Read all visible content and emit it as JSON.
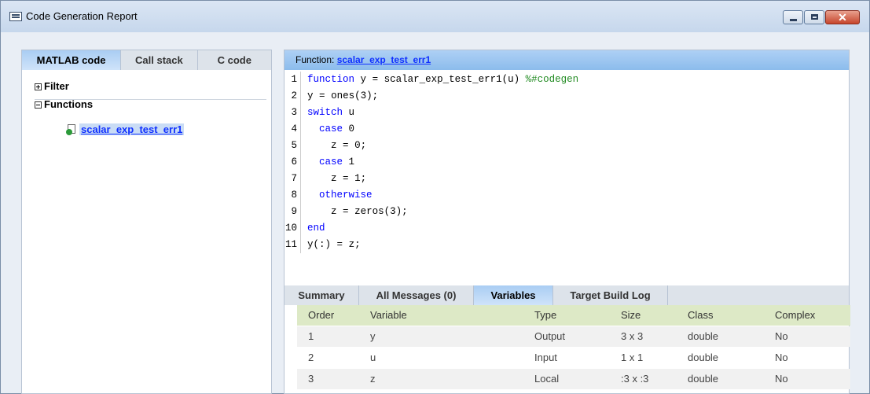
{
  "window": {
    "title": "Code Generation Report",
    "close_glyph": "✕"
  },
  "left_tabs": [
    "MATLAB code",
    "Call stack",
    "C code"
  ],
  "tree": {
    "filter_label": "Filter",
    "functions_label": "Functions",
    "function_item": "scalar_exp_test_err1"
  },
  "function_header": {
    "prefix": "Function:",
    "name": "scalar_exp_test_err1"
  },
  "code_lines": [
    {
      "num": "1",
      "text": "function y = scalar_exp_test_err1(u) %#codegen"
    },
    {
      "num": "2",
      "text": "y = ones(3);"
    },
    {
      "num": "3",
      "text": "switch u"
    },
    {
      "num": "4",
      "text": "  case 0"
    },
    {
      "num": "5",
      "text": "    z = 0;"
    },
    {
      "num": "6",
      "text": "  case 1"
    },
    {
      "num": "7",
      "text": "    z = 1;"
    },
    {
      "num": "8",
      "text": "  otherwise"
    },
    {
      "num": "9",
      "text": "    z = zeros(3);"
    },
    {
      "num": "10",
      "text": "end"
    },
    {
      "num": "11",
      "text": "y(:) = z;"
    }
  ],
  "bottom_tabs": [
    "Summary",
    "All Messages (0)",
    "Variables",
    "Target Build Log"
  ],
  "variables": {
    "columns": [
      "Order",
      "Variable",
      "Type",
      "Size",
      "Class",
      "Complex"
    ],
    "rows": [
      [
        "1",
        "y",
        "Output",
        "3 x 3",
        "double",
        "No"
      ],
      [
        "2",
        "u",
        "Input",
        "1 x 1",
        "double",
        "No"
      ],
      [
        "3",
        "z",
        "Local",
        ":3 x :3",
        "double",
        "No"
      ]
    ]
  },
  "colors": {
    "accent_tab": "#a9cdf3",
    "link": "#1030ff",
    "keyword": "#0000ff",
    "comment": "#228b22",
    "table_header": "#dde9c6"
  }
}
